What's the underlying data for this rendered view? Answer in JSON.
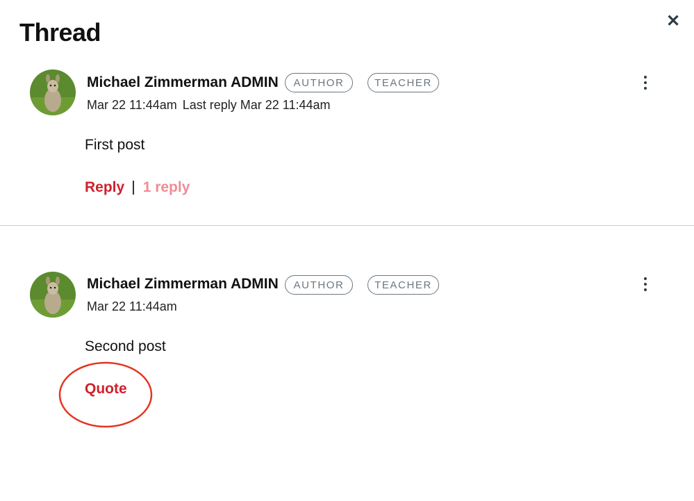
{
  "thread": {
    "title": "Thread"
  },
  "posts": [
    {
      "author": "Michael Zimmerman ADMIN",
      "badges": [
        "AUTHOR",
        "TEACHER"
      ],
      "timestamp": "Mar 22 11:44am",
      "last_reply": "Last reply Mar 22 11:44am",
      "body": "First post",
      "reply_label": "Reply",
      "reply_count": "1 reply"
    },
    {
      "author": "Michael Zimmerman ADMIN",
      "badges": [
        "AUTHOR",
        "TEACHER"
      ],
      "timestamp": "Mar 22 11:44am",
      "body": "Second post",
      "quote_label": "Quote"
    }
  ],
  "icons": {
    "close": "close-icon",
    "more": "more-options-icon"
  },
  "colors": {
    "accent": "#d0202d",
    "accent_muted": "#ef8c94",
    "badge": "#6b7780",
    "annotation": "#e5341f"
  }
}
